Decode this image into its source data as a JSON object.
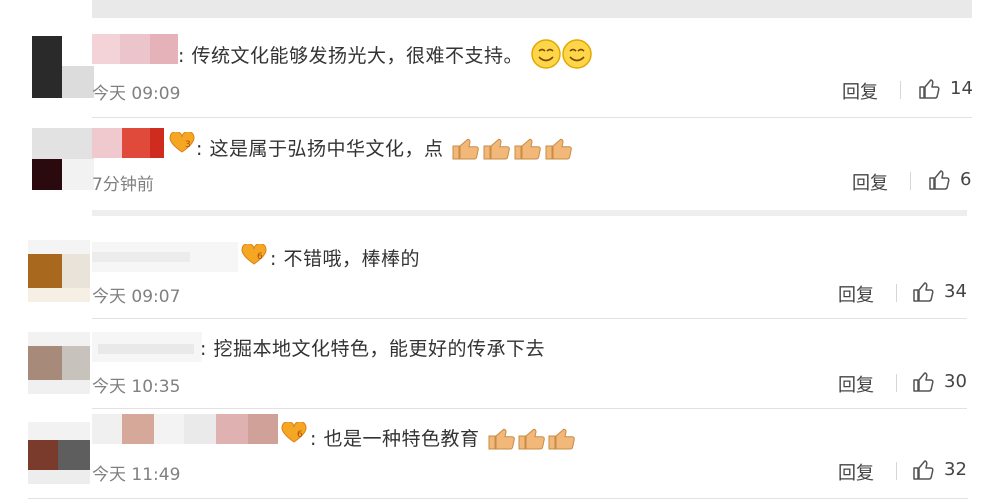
{
  "comments": [
    {
      "name_label": "",
      "text": ": 传统文化能够发扬光大，很难不支持。",
      "time": "今天 09:09",
      "reply": "回复",
      "likes": "14",
      "emoji": "smile-emoji"
    },
    {
      "name_label": "",
      "text": ": 这是属于弘扬中华文化，点",
      "time": "7分钟前",
      "reply": "回复",
      "likes": "6",
      "emoji": "thumbs-up-emoji"
    },
    {
      "name_label": "",
      "text": ": 不错哦，棒棒的",
      "time": "今天 09:07",
      "reply": "回复",
      "likes": "34"
    },
    {
      "name_label": "",
      "text": ": 挖掘本地文化特色，能更好的传承下去",
      "time": "今天 10:35",
      "reply": "回复",
      "likes": "30"
    },
    {
      "name_label": "",
      "text": ": 也是一种特色教育",
      "time": "今天 11:49",
      "reply": "回复",
      "likes": "32",
      "emoji": "thumbs-up-emoji"
    }
  ],
  "colors": {
    "time": "#808080",
    "text": "#333333",
    "badge": "#f5a623"
  }
}
